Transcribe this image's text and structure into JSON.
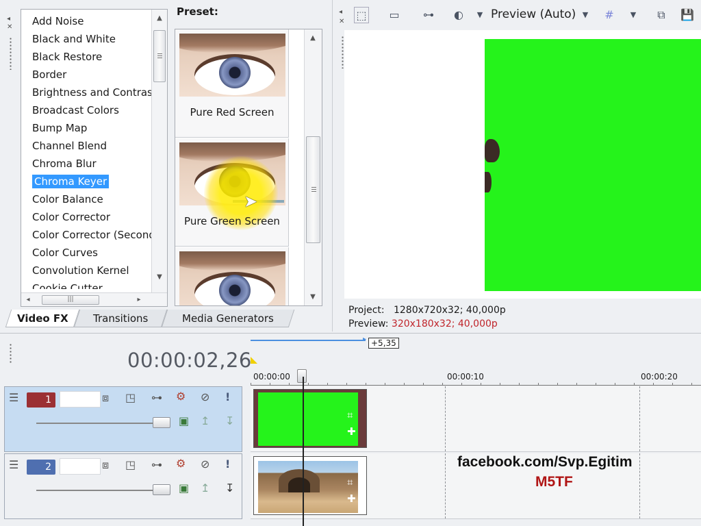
{
  "fx_list": {
    "items": [
      "Add Noise",
      "Black and White",
      "Black Restore",
      "Border",
      "Brightness and Contrast",
      "Broadcast Colors",
      "Bump Map",
      "Channel Blend",
      "Chroma Blur",
      "Chroma Keyer",
      "Color Balance",
      "Color Corrector",
      "Color Corrector (Secondary)",
      "Color Curves",
      "Convolution Kernel",
      "Cookie Cutter"
    ],
    "selected": "Chroma Keyer"
  },
  "presets": {
    "label": "Preset:",
    "items": [
      "Pure Red Screen",
      "Pure Green Screen",
      ""
    ]
  },
  "tabs": [
    "Video FX",
    "Transitions",
    "Media Generators"
  ],
  "preview": {
    "mode": "Preview (Auto)",
    "project_label": "Project:",
    "project_value": "1280x720x32; 40,000p",
    "preview_label": "Preview:",
    "preview_value": "320x180x32; 40,000p",
    "screen_color": "#25f31b"
  },
  "timeline": {
    "timecode": "00:00:02,26",
    "ruler_badge": "+5,35",
    "ticks": [
      "00:00:00",
      "00:00:10",
      "00:00:20"
    ],
    "tracks": [
      {
        "number": "1",
        "color": "#9b3034"
      },
      {
        "number": "2",
        "color": "#4f6fb0"
      }
    ]
  },
  "watermark": {
    "line1": "facebook.com/Svp.Egitim",
    "line2": "M5TF"
  },
  "icons": [
    "pointer-icon",
    "monitor-icon",
    "split-icon",
    "overlay-icon",
    "grid-icon",
    "copy-icon",
    "save-icon",
    "crop-icon",
    "pan-icon",
    "gear-icon",
    "bypass-icon",
    "solo-icon",
    "compositing-icon"
  ]
}
